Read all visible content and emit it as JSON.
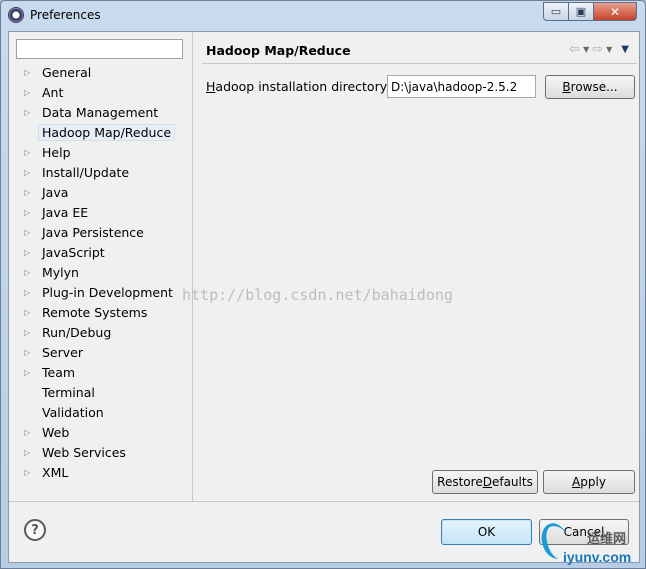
{
  "window": {
    "title": "Preferences"
  },
  "window_controls": {
    "minimize_glyph": "▭",
    "maximize_glyph": "▣",
    "close_glyph": "✕"
  },
  "filter": {
    "value": "",
    "placeholder": ""
  },
  "tree": {
    "items": [
      {
        "label": "General",
        "expandable": true,
        "selected": false
      },
      {
        "label": "Ant",
        "expandable": true,
        "selected": false
      },
      {
        "label": "Data Management",
        "expandable": true,
        "selected": false
      },
      {
        "label": "Hadoop Map/Reduce",
        "expandable": false,
        "selected": true
      },
      {
        "label": "Help",
        "expandable": true,
        "selected": false
      },
      {
        "label": "Install/Update",
        "expandable": true,
        "selected": false
      },
      {
        "label": "Java",
        "expandable": true,
        "selected": false
      },
      {
        "label": "Java EE",
        "expandable": true,
        "selected": false
      },
      {
        "label": "Java Persistence",
        "expandable": true,
        "selected": false
      },
      {
        "label": "JavaScript",
        "expandable": true,
        "selected": false
      },
      {
        "label": "Mylyn",
        "expandable": true,
        "selected": false
      },
      {
        "label": "Plug-in Development",
        "expandable": true,
        "selected": false
      },
      {
        "label": "Remote Systems",
        "expandable": true,
        "selected": false
      },
      {
        "label": "Run/Debug",
        "expandable": true,
        "selected": false
      },
      {
        "label": "Server",
        "expandable": true,
        "selected": false
      },
      {
        "label": "Team",
        "expandable": true,
        "selected": false
      },
      {
        "label": "Terminal",
        "expandable": false,
        "selected": false
      },
      {
        "label": "Validation",
        "expandable": false,
        "selected": false
      },
      {
        "label": "Web",
        "expandable": true,
        "selected": false
      },
      {
        "label": "Web Services",
        "expandable": true,
        "selected": false
      },
      {
        "label": "XML",
        "expandable": true,
        "selected": false
      }
    ]
  },
  "page": {
    "title": "Hadoop Map/Reduce",
    "field_label_mnemonic": "H",
    "field_label_rest": "adoop installation directory:",
    "field_value": "D:\\java\\hadoop-2.5.2",
    "browse_label": "Browse...",
    "browse_pre": "",
    "browse_mn": "B",
    "browse_post": "rowse..."
  },
  "nav": {
    "back_glyph": "⇦",
    "forward_glyph": "⇨",
    "dropdown_glyph": "▼",
    "menu_glyph": "▼"
  },
  "buttons": {
    "restore_pre": "Restore ",
    "restore_mn": "D",
    "restore_post": "efaults",
    "apply_pre": "",
    "apply_mn": "A",
    "apply_post": "pply",
    "ok": "OK",
    "cancel": "Cancel",
    "help_glyph": "?"
  },
  "watermark": "http://blog.csdn.net/bahaidong",
  "logo": {
    "cn_text": "运维网",
    "site_text": "iyunv.com"
  },
  "colors": {
    "ok_accent": "#3c7fb1",
    "close_button": "#c7432a",
    "selection_bg": "#e8eef7"
  }
}
